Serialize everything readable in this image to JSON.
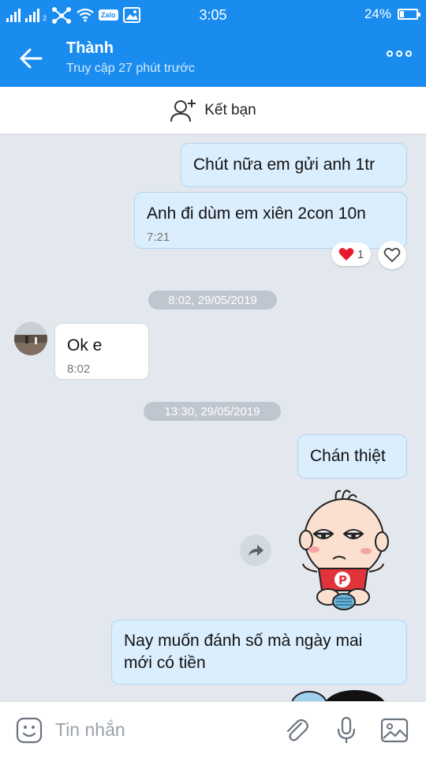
{
  "status_bar": {
    "sim_label": "2",
    "zalo_label": "Zalo",
    "time": "3:05",
    "battery": "24%",
    "battery_level": 0.24
  },
  "header": {
    "contact_name": "Thành",
    "last_seen": "Truy cập 27 phút trước"
  },
  "friend_bar": {
    "label": "Kết bạn"
  },
  "messages": [
    {
      "text": "Chút nữa em gửi anh 1tr",
      "direction": "outgoing"
    },
    {
      "text": "Anh đi dùm em xiên 2con 10n",
      "time": "7:21",
      "direction": "outgoing",
      "reaction_count": "1"
    },
    {
      "date_separator": "8:02, 29/05/2019"
    },
    {
      "text": "Ok e",
      "time": "8:02",
      "direction": "incoming"
    },
    {
      "date_separator": "13:30, 29/05/2019"
    },
    {
      "text": "Chán thiệt",
      "direction": "outgoing"
    },
    {
      "sticker": "bored-baby-sticker",
      "sticker_text": "P",
      "direction": "outgoing"
    },
    {
      "text_line1": "Nay muốn đánh số mà ngày mai",
      "text_line2": "mới có tiền",
      "direction": "outgoing"
    }
  ],
  "input_bar": {
    "placeholder": "Tin nhắn"
  },
  "icons": {
    "back": "arrow-left-icon",
    "more": "more-dots-icon",
    "add_friend": "add-person-icon",
    "reaction": "heart-icon",
    "like": "heart-outline-icon",
    "forward": "forward-icon",
    "emoji": "emoji-icon",
    "attach": "paperclip-icon",
    "mic": "microphone-icon",
    "image": "image-icon"
  },
  "colors": {
    "primary": "#1a8cf0",
    "chat_background": "#e3e8ef",
    "outgoing_bubble": "#dbeefd",
    "incoming_bubble": "#ffffff",
    "reaction_heart": "#e8192c"
  }
}
